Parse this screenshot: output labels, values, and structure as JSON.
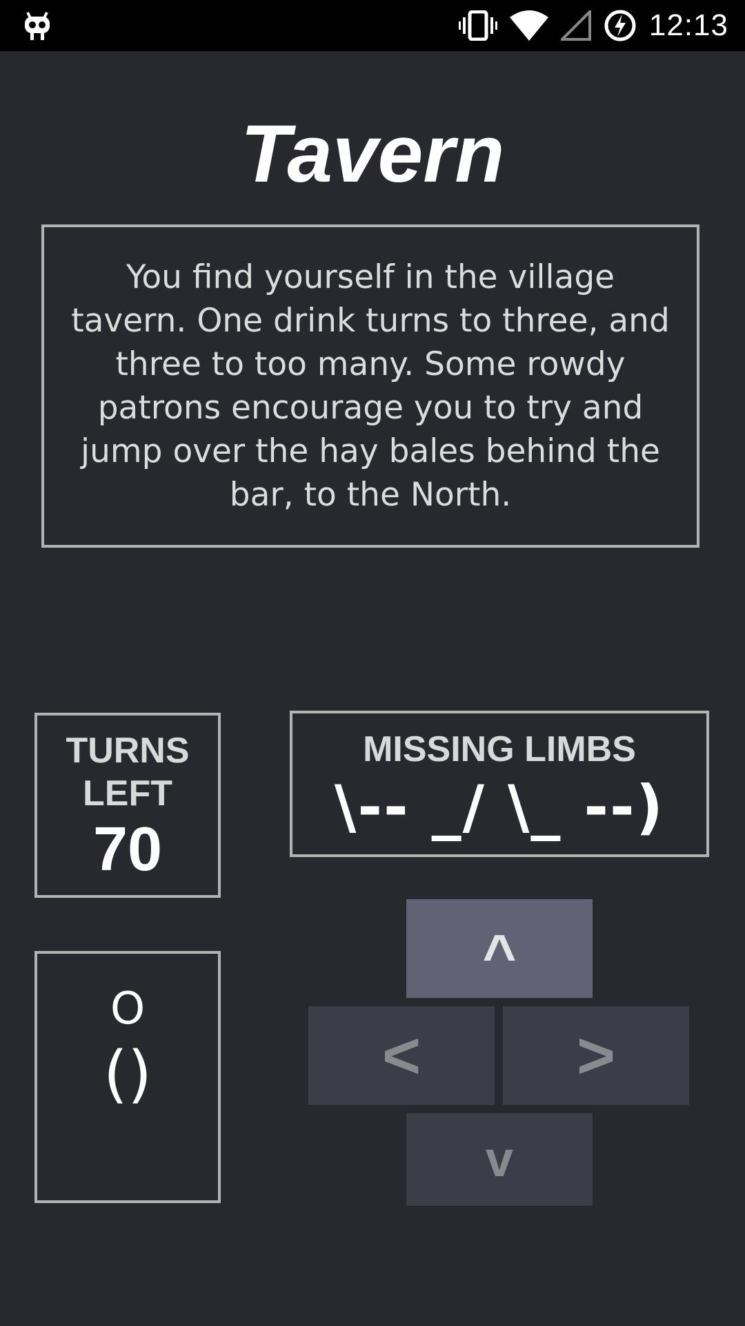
{
  "status_bar": {
    "time": "12:13",
    "left_icon": "android-robot-icon",
    "icons": [
      "vibrate-icon",
      "wifi-icon",
      "signal-icon",
      "battery-charging-icon"
    ]
  },
  "location": {
    "title": "Tavern",
    "description": "You find yourself in the village tavern. One drink turns to three, and three to too many. Some rowdy patrons encourage you to try and jump over the hay bales behind the bar, to the North."
  },
  "turns": {
    "label": "TURNS LEFT",
    "value": "70"
  },
  "limbs": {
    "label": "MISSING LIMBS",
    "value": "\\-- _/ \\_ --)"
  },
  "character": {
    "head": "O",
    "body": "()"
  },
  "controls": {
    "up": "^",
    "left": "<",
    "right": ">",
    "down": "v"
  },
  "colors": {
    "background": "#28292e",
    "border": "#b3b3b3",
    "button": "#3d3d49",
    "button_active": "#626274"
  }
}
